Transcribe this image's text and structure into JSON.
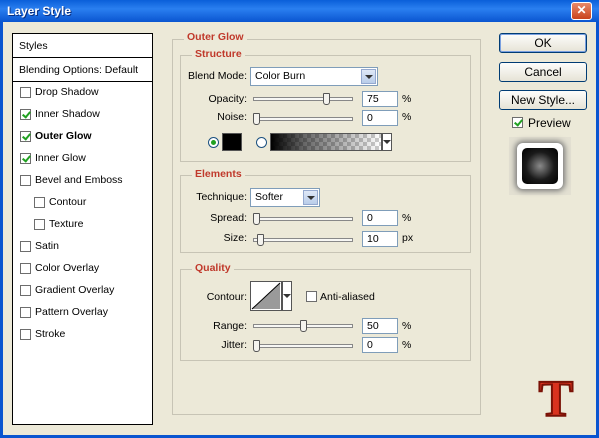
{
  "window": {
    "title": "Layer Style",
    "close_label": "✕"
  },
  "styles_panel": {
    "header": "Styles",
    "blending": "Blending Options: Default",
    "items": [
      {
        "label": "Drop Shadow",
        "checked": false,
        "bold": false,
        "indent": false
      },
      {
        "label": "Inner Shadow",
        "checked": true,
        "bold": false,
        "indent": false
      },
      {
        "label": "Outer Glow",
        "checked": true,
        "bold": true,
        "indent": false
      },
      {
        "label": "Inner Glow",
        "checked": true,
        "bold": false,
        "indent": false
      },
      {
        "label": "Bevel and Emboss",
        "checked": false,
        "bold": false,
        "indent": false
      },
      {
        "label": "Contour",
        "checked": false,
        "bold": false,
        "indent": true
      },
      {
        "label": "Texture",
        "checked": false,
        "bold": false,
        "indent": true
      },
      {
        "label": "Satin",
        "checked": false,
        "bold": false,
        "indent": false
      },
      {
        "label": "Color Overlay",
        "checked": false,
        "bold": false,
        "indent": false
      },
      {
        "label": "Gradient Overlay",
        "checked": false,
        "bold": false,
        "indent": false
      },
      {
        "label": "Pattern Overlay",
        "checked": false,
        "bold": false,
        "indent": false
      },
      {
        "label": "Stroke",
        "checked": false,
        "bold": false,
        "indent": false
      }
    ]
  },
  "outer_glow": {
    "title": "Outer Glow",
    "structure": {
      "title": "Structure",
      "blend_mode_label": "Blend Mode:",
      "blend_mode_value": "Color Burn",
      "opacity_label": "Opacity:",
      "opacity_value": "75",
      "opacity_unit": "%",
      "opacity_level": 0.75,
      "noise_label": "Noise:",
      "noise_value": "0",
      "noise_unit": "%",
      "noise_level": 0.0
    },
    "elements": {
      "title": "Elements",
      "technique_label": "Technique:",
      "technique_value": "Softer",
      "spread_label": "Spread:",
      "spread_value": "0",
      "spread_unit": "%",
      "spread_level": 0.0,
      "size_label": "Size:",
      "size_value": "10",
      "size_unit": "px",
      "size_level": 0.04
    },
    "quality": {
      "title": "Quality",
      "contour_label": "Contour:",
      "anti_aliased_label": "Anti-aliased",
      "anti_aliased_checked": false,
      "range_label": "Range:",
      "range_value": "50",
      "range_unit": "%",
      "range_level": 0.5,
      "jitter_label": "Jitter:",
      "jitter_value": "0",
      "jitter_unit": "%",
      "jitter_level": 0.0
    }
  },
  "buttons": {
    "ok": "OK",
    "cancel": "Cancel",
    "new_style": "New Style..."
  },
  "preview": {
    "label": "Preview",
    "checked": true
  },
  "logo": {
    "letter": "T"
  },
  "colors": {
    "accent": "#c0392b",
    "title_bar": "#0a55d0",
    "glow_color": "#000000"
  }
}
